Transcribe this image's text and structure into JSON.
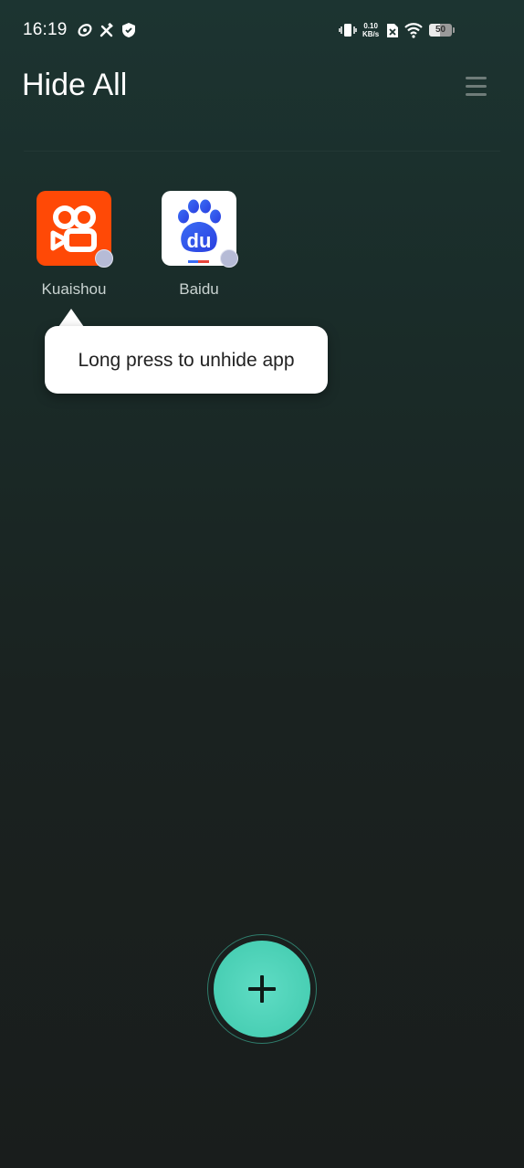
{
  "status_bar": {
    "time": "16:19",
    "net_speed_value": "0.10",
    "net_speed_unit": "KB/s",
    "battery_level": "50",
    "icons": [
      "sync-icon",
      "tools-icon",
      "shield-icon",
      "vibrate-icon",
      "sim-x-icon",
      "wifi-icon",
      "battery-icon"
    ]
  },
  "header": {
    "title": "Hide All",
    "menu_icon": "menu-icon"
  },
  "apps": [
    {
      "label": "Kuaishou",
      "icon": "kuaishou-icon",
      "color": "#ff4906"
    },
    {
      "label": "Baidu",
      "icon": "baidu-icon",
      "color": "#ffffff"
    }
  ],
  "tooltip": {
    "text": "Long press to unhide app"
  },
  "fab": {
    "icon": "plus-icon",
    "color": "#4fd6bc"
  },
  "colors": {
    "accent": "#4fd6bc",
    "background_top": "#1c3431",
    "background_bottom": "#191d1c"
  }
}
